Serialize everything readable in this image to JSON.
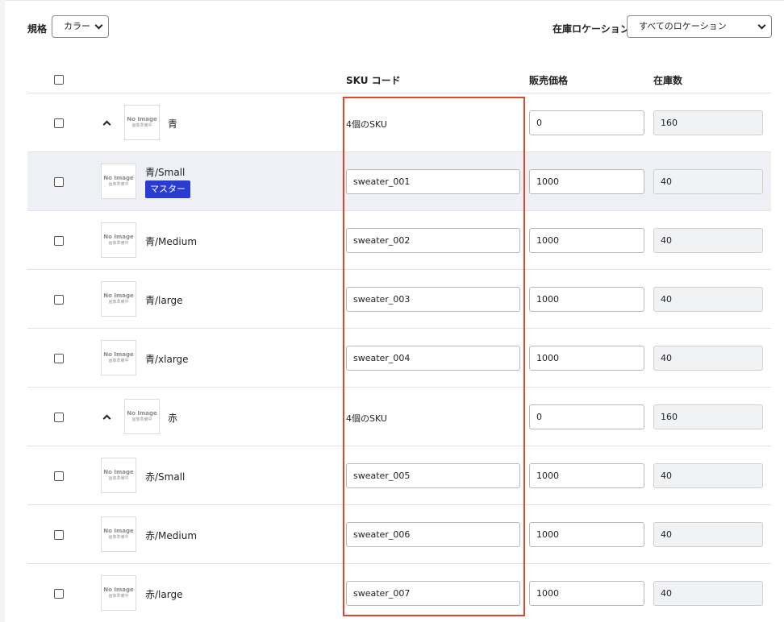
{
  "filters": {
    "spec_label": "規格",
    "spec_value": "カラー",
    "location_label": "在庫ロケーション",
    "location_value": "すべてのロケーション"
  },
  "table": {
    "headers": {
      "sku": "SKU コード",
      "price": "販売価格",
      "stock": "在庫数"
    },
    "no_image": {
      "line1": "No Image",
      "line2": "画像準備中"
    },
    "rows": [
      {
        "type": "group",
        "name": "青",
        "sku": "4個のSKU",
        "price": "0",
        "stock": "160"
      },
      {
        "type": "variant",
        "name": "青/Small",
        "badge": "マスター",
        "sku": "sweater_001",
        "price": "1000",
        "stock": "40"
      },
      {
        "type": "variant",
        "name": "青/Medium",
        "sku": "sweater_002",
        "price": "1000",
        "stock": "40"
      },
      {
        "type": "variant",
        "name": "青/large",
        "sku": "sweater_003",
        "price": "1000",
        "stock": "40"
      },
      {
        "type": "variant",
        "name": "青/xlarge",
        "sku": "sweater_004",
        "price": "1000",
        "stock": "40"
      },
      {
        "type": "group",
        "name": "赤",
        "sku": "4個のSKU",
        "price": "0",
        "stock": "160"
      },
      {
        "type": "variant",
        "name": "赤/Small",
        "sku": "sweater_005",
        "price": "1000",
        "stock": "40"
      },
      {
        "type": "variant",
        "name": "赤/Medium",
        "sku": "sweater_006",
        "price": "1000",
        "stock": "40"
      },
      {
        "type": "variant",
        "name": "赤/large",
        "sku": "sweater_007",
        "price": "1000",
        "stock": "40"
      }
    ]
  },
  "colors": {
    "highlight": "#e0462a",
    "badge": "#2a3bd1",
    "selected_row": "#eef0f5"
  }
}
